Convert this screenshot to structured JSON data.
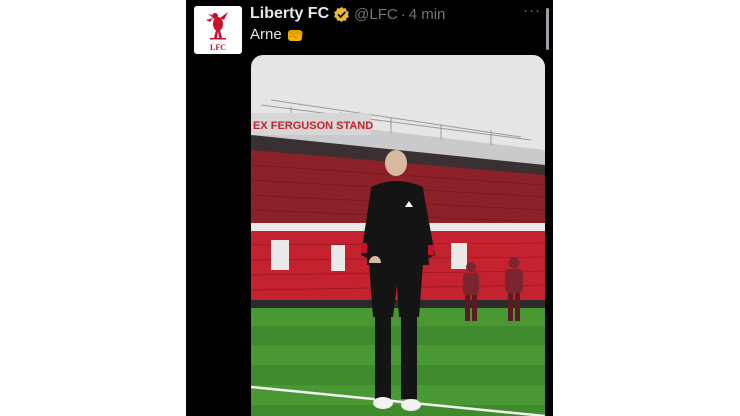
{
  "tweet": {
    "author_name": "Liberty FC",
    "handle": "@LFC",
    "separator": "·",
    "time": "4 min",
    "text": "Arne",
    "more_label": "···"
  },
  "avatar": {
    "logo_text": "LFC",
    "brand_color": "#c8102e"
  },
  "photo": {
    "stand_text": "EX FERGUSON STAND"
  },
  "colors": {
    "verified": "#e8b931",
    "pitch": "#3f8a2c",
    "seats": "#c4222e"
  }
}
